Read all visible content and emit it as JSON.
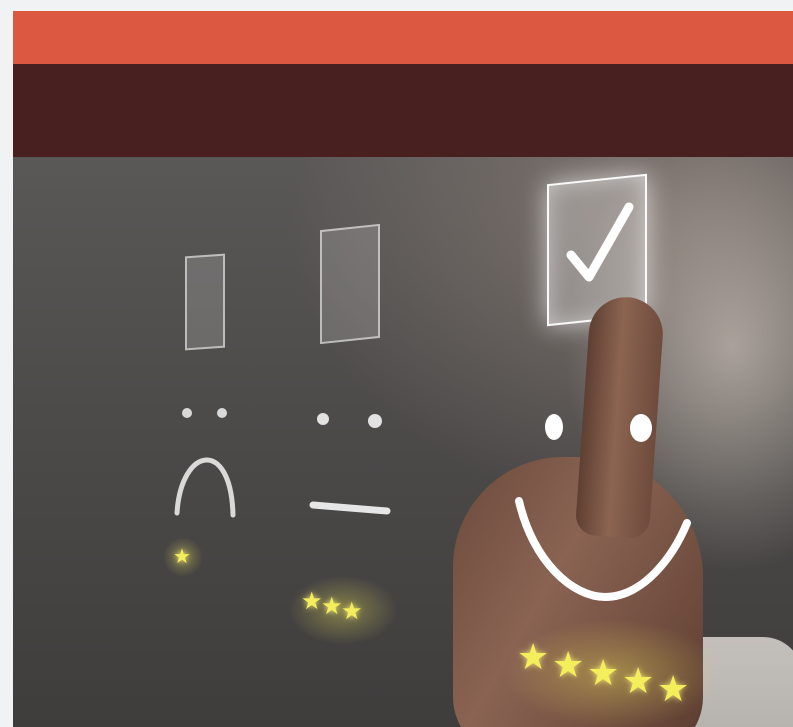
{
  "page": {
    "frame_bg": "#f1f2f4"
  },
  "header": {
    "topbar_color": "#dc5840",
    "navbar_color": "#47201f"
  },
  "hero": {
    "image_subject": "hand-pressing-rating-checkbox",
    "ratings": [
      {
        "face": "sad",
        "stars": 1
      },
      {
        "face": "neutral",
        "stars": 3
      },
      {
        "face": "happy",
        "stars": 5,
        "checked": true
      }
    ],
    "icons": [
      "checkmark-icon",
      "star-icon"
    ],
    "star_color": "#f5ee5c"
  }
}
